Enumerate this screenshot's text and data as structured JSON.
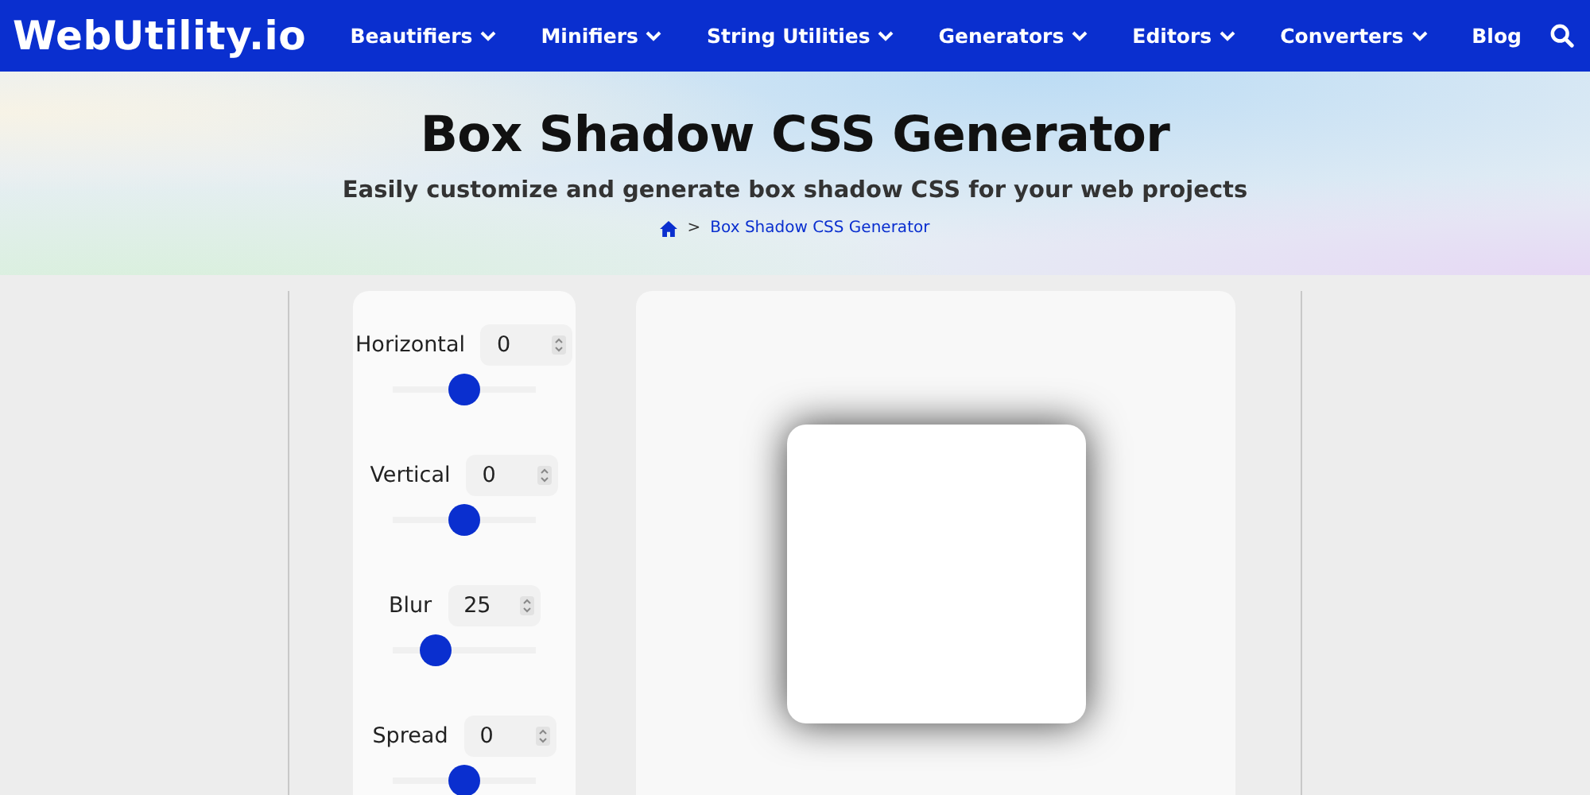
{
  "nav": {
    "logo": "WebUtility.io",
    "items": [
      {
        "label": "Beautifiers",
        "dropdown": true
      },
      {
        "label": "Minifiers",
        "dropdown": true
      },
      {
        "label": "String Utilities",
        "dropdown": true
      },
      {
        "label": "Generators",
        "dropdown": true
      },
      {
        "label": "Editors",
        "dropdown": true
      },
      {
        "label": "Converters",
        "dropdown": true
      },
      {
        "label": "Blog",
        "dropdown": false
      }
    ]
  },
  "hero": {
    "title": "Box Shadow CSS Generator",
    "subtitle": "Easily customize and generate box shadow CSS for your web projects",
    "breadcrumb": {
      "separator": ">",
      "current": "Box Shadow CSS Generator"
    }
  },
  "controls": [
    {
      "label": "Horizontal",
      "value": "0",
      "level": 0.5
    },
    {
      "label": "Vertical",
      "value": "0",
      "level": 0.5
    },
    {
      "label": "Blur",
      "value": "25",
      "level": 0.3
    },
    {
      "label": "Spread",
      "value": "0",
      "level": 0.5
    }
  ]
}
